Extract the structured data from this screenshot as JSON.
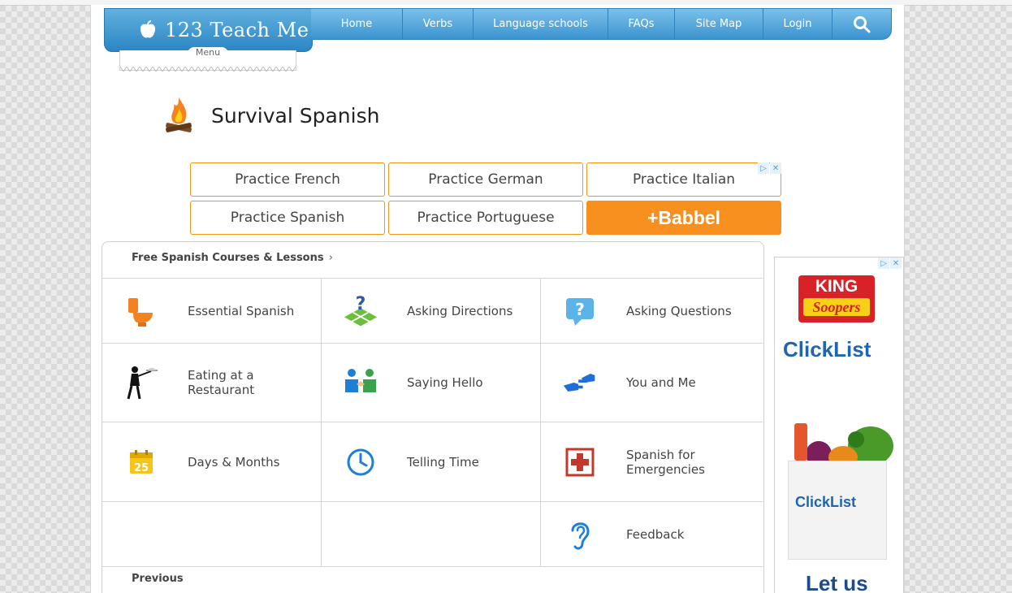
{
  "header": {
    "logo_text": "123 Teach Me",
    "menu_label": "Menu",
    "nav": [
      "Home",
      "Verbs",
      "Language schools",
      "FAQs",
      "Site Map",
      "Login"
    ]
  },
  "page": {
    "title": "Survival Spanish"
  },
  "practice": {
    "items": [
      "Practice French",
      "Practice German",
      "Practice Italian",
      "Practice Spanish",
      "Practice Portuguese"
    ],
    "brand": "+Babbel"
  },
  "lessons": {
    "breadcrumb": "Free Spanish Courses & Lessons",
    "items": [
      {
        "label": "Essential Spanish",
        "icon": "toilet-icon"
      },
      {
        "label": "Asking Directions",
        "icon": "map-question-icon"
      },
      {
        "label": "Asking Questions",
        "icon": "speech-question-icon"
      },
      {
        "label": "Eating at a Restaurant",
        "icon": "waiter-icon"
      },
      {
        "label": "Saying Hello",
        "icon": "handshake-icon"
      },
      {
        "label": "You and Me",
        "icon": "pointing-hands-icon"
      },
      {
        "label": "Days & Months",
        "icon": "calendar-icon"
      },
      {
        "label": "Telling Time",
        "icon": "clock-icon"
      },
      {
        "label": "Spanish for Emergencies",
        "icon": "first-aid-icon"
      },
      {
        "label": "",
        "icon": ""
      },
      {
        "label": "",
        "icon": ""
      },
      {
        "label": "Feedback",
        "icon": "ear-icon"
      }
    ],
    "calendar_day": "25",
    "previous": "Previous"
  },
  "ad": {
    "brand_top": "KING",
    "brand_bottom": "Soopers",
    "clicklist": "ClickList",
    "bag_text": "ClickList",
    "tagline": "Let us"
  },
  "colors": {
    "nav_blue": "#3b94cf",
    "accent_orange": "#f7901e",
    "clicklist_blue": "#1c66b3"
  }
}
